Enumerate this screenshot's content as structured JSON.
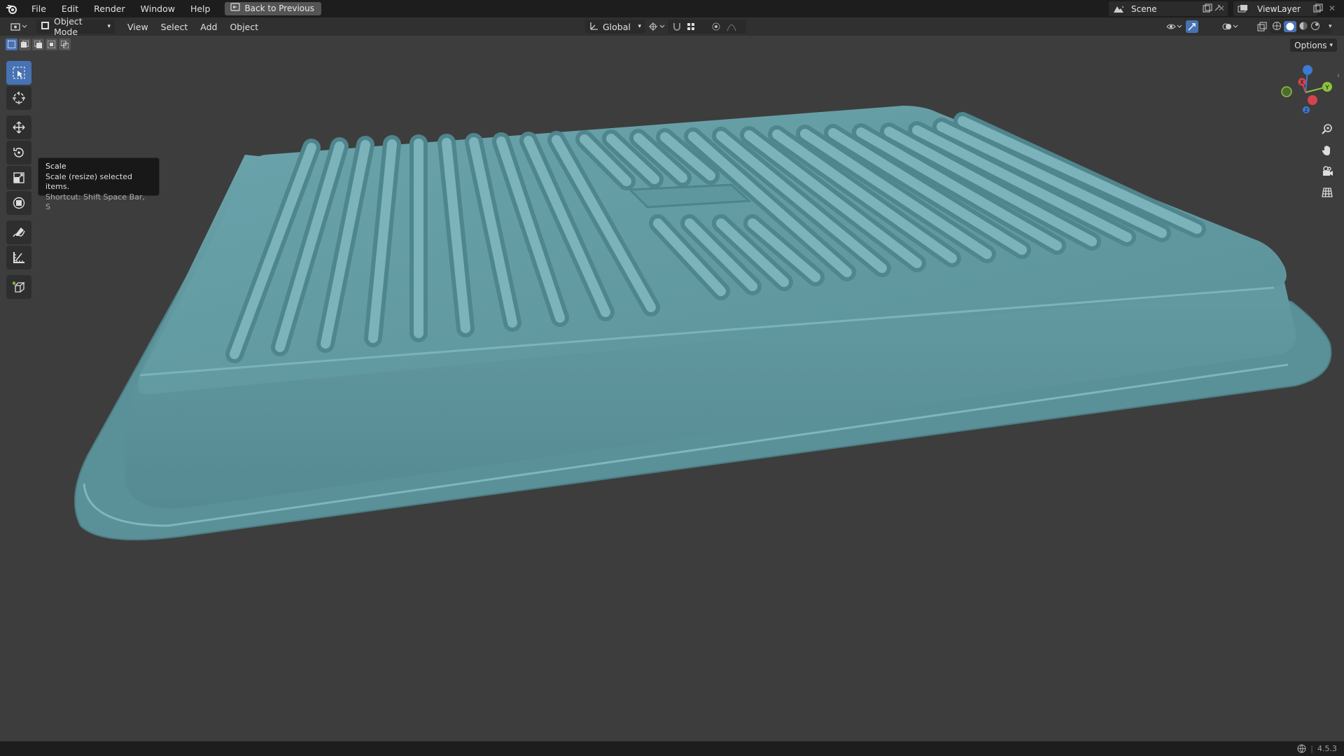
{
  "topbar": {
    "menus": [
      "File",
      "Edit",
      "Render",
      "Window",
      "Help"
    ],
    "back_label": "Back to Previous",
    "scene_label": "Scene",
    "viewlayer_label": "ViewLayer"
  },
  "header": {
    "mode_label": "Object Mode",
    "menus": [
      "View",
      "Select",
      "Add",
      "Object"
    ],
    "orientation_label": "Global"
  },
  "viewport": {
    "options_label": "Options",
    "tooltip": {
      "title": "Scale",
      "description": "Scale (resize) selected items.",
      "shortcut": "Shortcut: Shift Space Bar, S"
    },
    "gizmo_axes": [
      "X",
      "Y",
      "Z"
    ],
    "object_color": "#5f969e"
  },
  "status": {
    "version": "4.5.3"
  },
  "colors": {
    "accent": "#4772b3",
    "background": "#3d3d3d",
    "axis_x": "#d4444f",
    "axis_y": "#8bc43c",
    "axis_z": "#3c7ad4"
  }
}
